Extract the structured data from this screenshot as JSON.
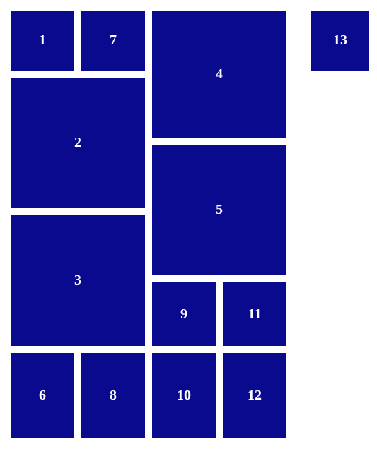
{
  "tiles": {
    "t1": "1",
    "t2": "2",
    "t3": "3",
    "t4": "4",
    "t5": "5",
    "t6": "6",
    "t7": "7",
    "t8": "8",
    "t9": "9",
    "t10": "10",
    "t11": "11",
    "t12": "12",
    "t13": "13"
  }
}
